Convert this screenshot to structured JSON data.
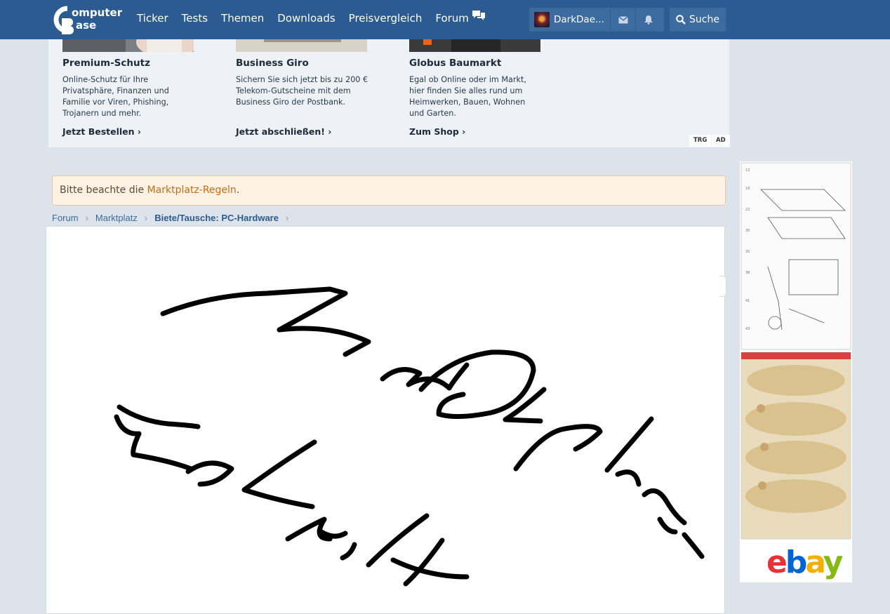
{
  "site": {
    "logo_alt": "ComputerBase"
  },
  "nav": {
    "items": [
      {
        "label": "Ticker"
      },
      {
        "label": "Tests"
      },
      {
        "label": "Themen"
      },
      {
        "label": "Downloads"
      },
      {
        "label": "Preisvergleich"
      },
      {
        "label": "Forum"
      }
    ],
    "forum_icon": "chat-bubbles-icon"
  },
  "user": {
    "name": "DarkDae...",
    "avatar_icon": "avatar",
    "messages_icon": "envelope-icon",
    "alerts_icon": "bell-icon"
  },
  "search": {
    "label": "Suche",
    "icon": "search-icon"
  },
  "ads": {
    "cards": [
      {
        "title": "Premium-Schutz",
        "desc": "Online-Schutz für Ihre Privatsphäre, Finanzen und Familie vor Viren, Phishing, Trojanern und mehr.",
        "cta": "Jetzt Bestellen  ›"
      },
      {
        "title": "Business Giro",
        "desc": "Sichern Sie sich jetzt bis zu 200 € Telekom-Gutscheine mit dem Business Giro der Postbank.",
        "cta": "Jetzt abschließen!  ›"
      },
      {
        "title": "Globus Baumarkt",
        "desc": "Egal ob Online oder im Markt, hier finden Sie alles rund um Heimwerken, Bauen, Wohnen und Garten.",
        "cta": "Zum Shop  ›"
      }
    ],
    "tag_trg": "TRG",
    "tag_ad": "AD"
  },
  "notice": {
    "prefix": "Bitte beachte die ",
    "link": "Marktplatz-Regeln",
    "suffix": "."
  },
  "breadcrumb": {
    "items": [
      {
        "label": "Forum"
      },
      {
        "label": "Marktplatz"
      },
      {
        "label": "Biete/Tausche: PC-Hardware"
      }
    ]
  },
  "colors": {
    "header": "#2b5b90",
    "link": "#3d6b9f",
    "notice_link": "#c46d16",
    "ebay_red": "#e53238",
    "ebay_blue": "#0064d2",
    "ebay_yellow": "#f5af02",
    "ebay_green": "#86b817"
  },
  "side_ad": {
    "brand": "ebay"
  }
}
